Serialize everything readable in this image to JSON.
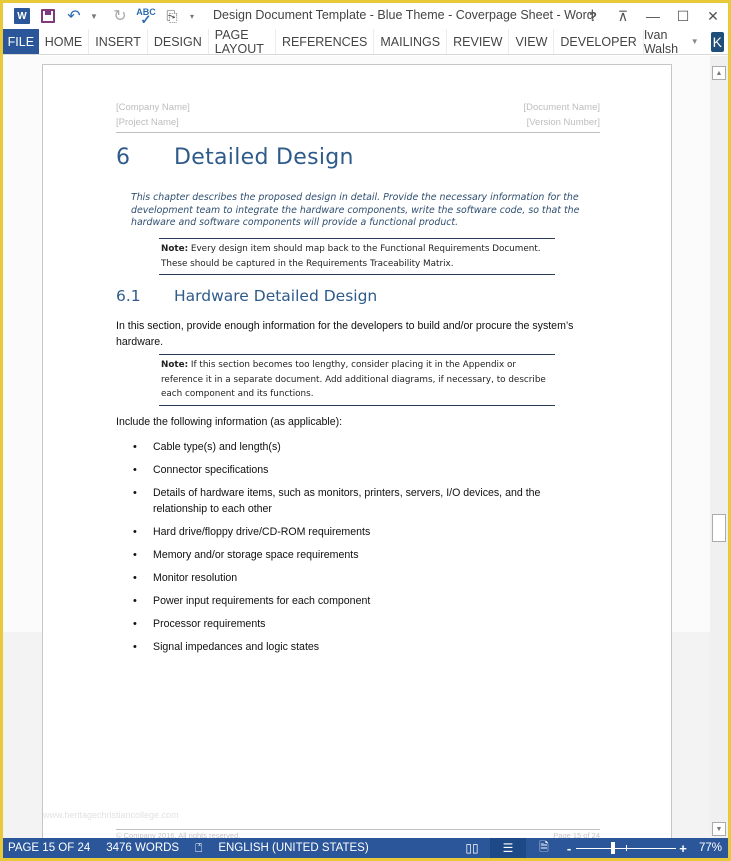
{
  "window": {
    "title": "Design Document Template - Blue Theme - Coverpage Sheet - Word",
    "controls": [
      "?",
      "restore-ribbon",
      "minimize",
      "maximize",
      "close"
    ]
  },
  "qat": {
    "icons": [
      "word-logo",
      "save-icon",
      "undo-icon",
      "redo-icon",
      "spelling-check-icon",
      "new-comment-icon",
      "customize-qat-icon"
    ]
  },
  "ribbon": {
    "file_label": "FILE",
    "tabs": [
      "HOME",
      "INSERT",
      "DESIGN",
      "PAGE LAYOUT",
      "REFERENCES",
      "MAILINGS",
      "REVIEW",
      "VIEW",
      "DEVELOPER"
    ],
    "user_name": "Ivan Walsh",
    "avatar_letter": "K"
  },
  "document": {
    "header": {
      "company": "[Company Name]",
      "document_name": "[Document Name]",
      "project": "[Project Name]",
      "version": "[Version Number]"
    },
    "heading1": {
      "number": "6",
      "text": "Detailed Design"
    },
    "intro": "This chapter describes the proposed design in detail. Provide the necessary information for the development team to integrate the hardware components, write the software code, so that the hardware and software components will provide a functional product.",
    "note1": {
      "label": "Note:",
      "text": " Every design item should map back to the Functional Requirements Document. These should be captured in the Requirements Traceability Matrix."
    },
    "heading2": {
      "number": "6.1",
      "text": "Hardware Detailed Design"
    },
    "body": "In this section, provide enough information for the developers to build and/or procure the system’s hardware.",
    "note2": {
      "label": "Note:",
      "text": " If this section becomes too lengthy, consider placing it in the Appendix or reference it in a separate document. Add additional diagrams, if necessary, to describe each component and its functions."
    },
    "include_text": "Include the following information (as applicable):",
    "bullets": [
      "Cable type(s) and length(s)",
      "Connector specifications",
      "Details of hardware items, such as monitors, printers, servers, I/O devices, and the relationship to each other",
      "Hard drive/floppy drive/CD-ROM requirements",
      "Memory and/or storage space requirements",
      "Monitor resolution",
      "Power input requirements for each component",
      "Processor requirements",
      "Signal impedances and logic states"
    ],
    "footer": {
      "copyright": "© Company 2016. All rights reserved.",
      "page": "Page 15 of 24"
    },
    "watermark": "www.heritagechristiancollege.com"
  },
  "statusbar": {
    "page": "PAGE 15 OF 24",
    "words": "3476 WORDS",
    "language": "ENGLISH (UNITED STATES)",
    "zoom_percent": 77,
    "zoom_label": "77%",
    "active_view": "print-layout"
  }
}
